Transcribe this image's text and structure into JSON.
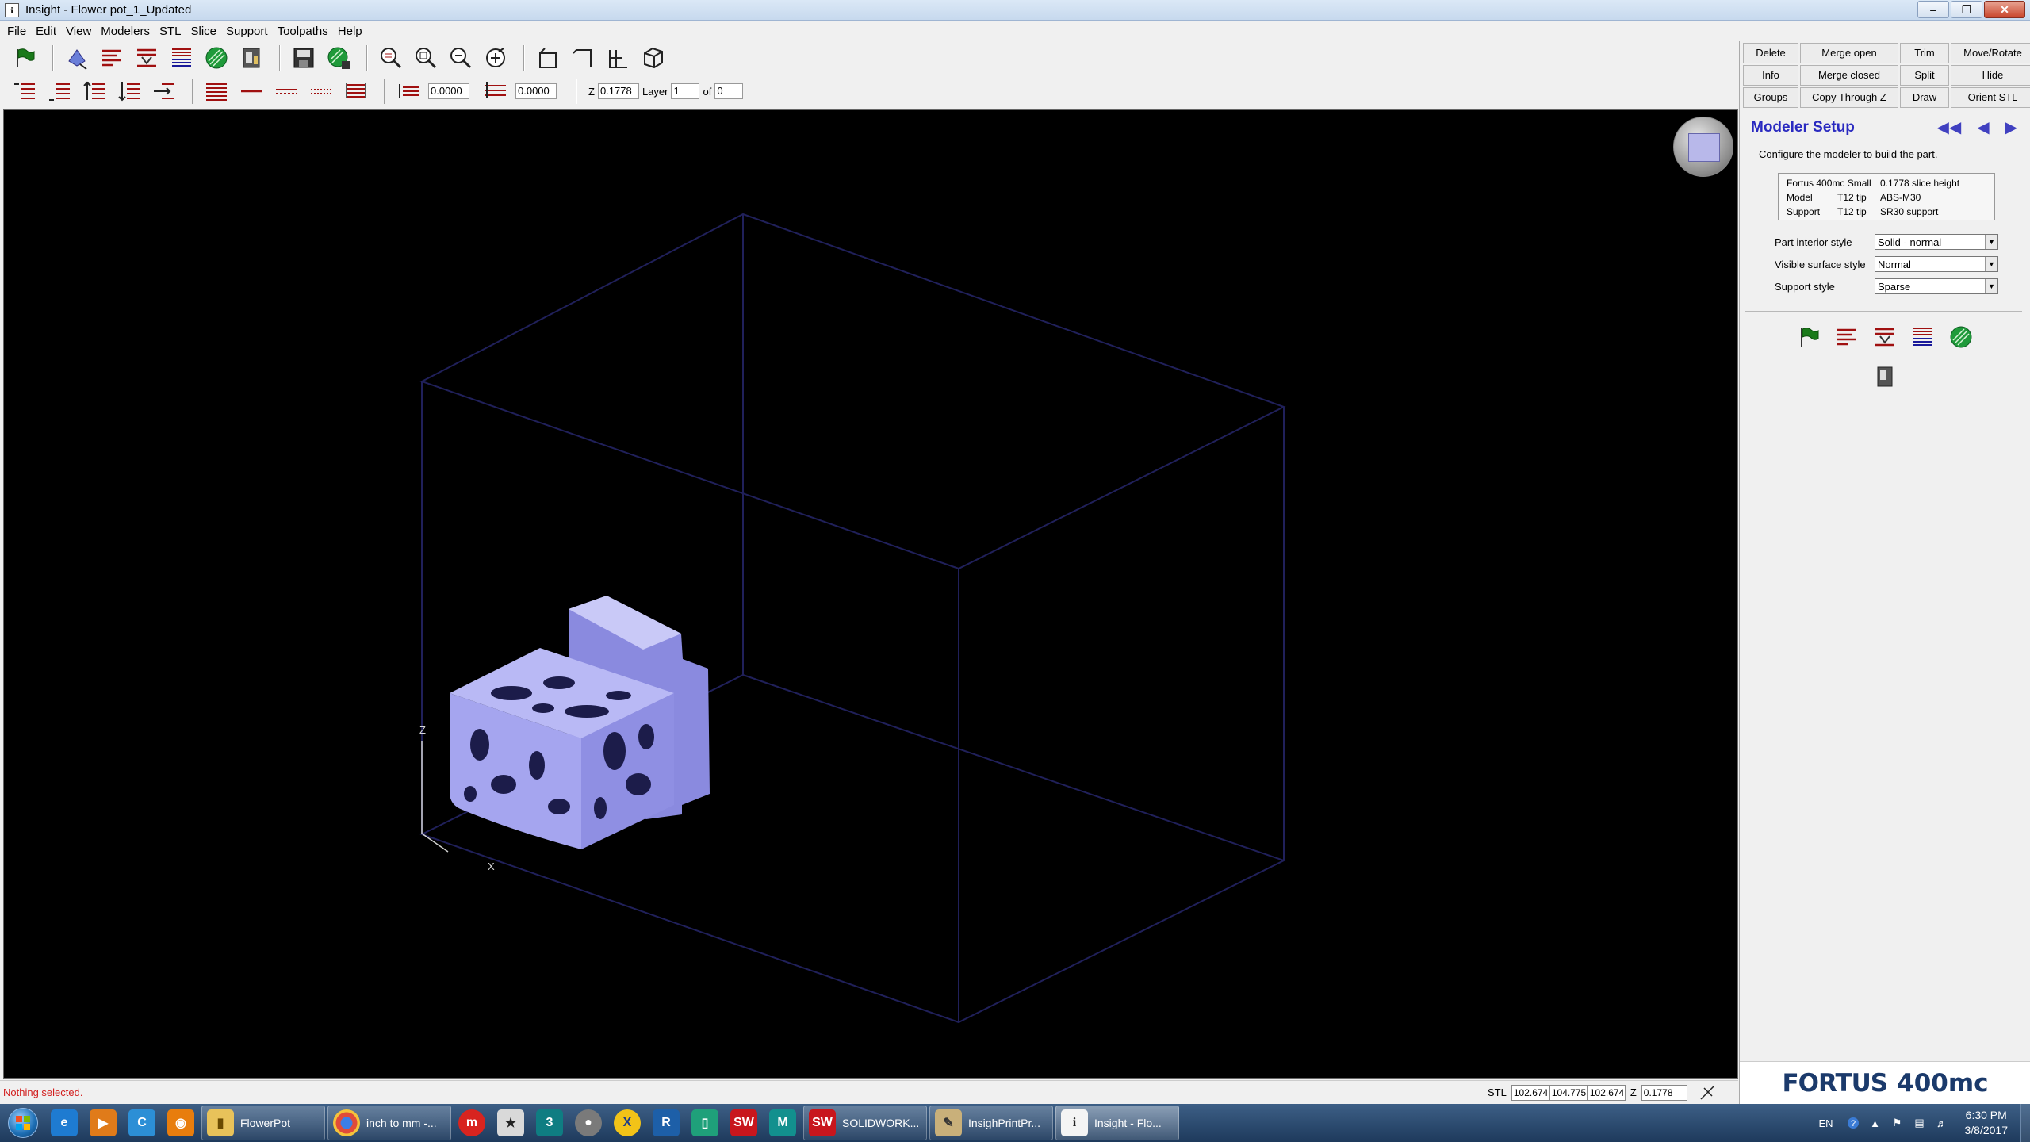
{
  "window": {
    "title": "Insight - Flower pot_1_Updated"
  },
  "menu": [
    "File",
    "Edit",
    "View",
    "Modelers",
    "STL",
    "Slice",
    "Support",
    "Toolpaths",
    "Help"
  ],
  "toolbar2": {
    "offset1": "0.0000",
    "offset2": "0.0000",
    "z_label": "Z",
    "z_value": "0.1778",
    "layer_label": "Layer",
    "layer_value": "1",
    "of_label": "of",
    "of_value": "0"
  },
  "viewport": {
    "axis_z": "Z",
    "axis_x": "X",
    "part_color": "#a5a5ef",
    "box_color": "#20205a"
  },
  "operations": [
    [
      "Delete",
      "Merge open",
      "Trim",
      "Move/Rotate"
    ],
    [
      "Info",
      "Merge closed",
      "Split",
      "Hide"
    ],
    [
      "Groups",
      "Copy Through Z",
      "Draw",
      "Orient STL"
    ]
  ],
  "panel": {
    "title": "Modeler Setup",
    "description": "Configure the modeler to build the part.",
    "info_rows": [
      [
        "Fortus 400mc Small",
        "",
        "0.1778 slice height"
      ],
      [
        "Model",
        "T12 tip",
        "ABS-M30"
      ],
      [
        "Support",
        "T12 tip",
        "SR30 support"
      ]
    ],
    "fields": [
      {
        "label": "Part interior style",
        "value": "Solid - normal"
      },
      {
        "label": "Visible surface style",
        "value": "Normal"
      },
      {
        "label": "Support style",
        "value": "Sparse"
      }
    ],
    "brand_name": "FORTUS",
    "brand_model": "400mc"
  },
  "status": {
    "message": "Nothing selected.",
    "stl_label": "STL",
    "values": [
      "102.674",
      "104.775",
      "102.674"
    ],
    "z_label": "Z",
    "z_value": "0.1778"
  },
  "taskbar": {
    "apps": [
      {
        "icon": "internet-explorer-icon",
        "label": ""
      },
      {
        "icon": "media-player-icon",
        "label": ""
      },
      {
        "icon": "ccleaner-icon",
        "label": ""
      },
      {
        "icon": "blender-icon",
        "label": ""
      },
      {
        "icon": "folder-icon",
        "label": "FlowerPot"
      },
      {
        "icon": "chrome-icon",
        "label": "inch to mm -..."
      },
      {
        "icon": "makerbot-icon",
        "label": ""
      },
      {
        "icon": "zbrush-icon",
        "label": ""
      },
      {
        "icon": "3dsmax-icon",
        "label": ""
      },
      {
        "icon": "keyshot-icon",
        "label": ""
      },
      {
        "icon": "xmind-icon",
        "label": ""
      },
      {
        "icon": "revit-icon",
        "label": ""
      },
      {
        "icon": "grabcad-icon",
        "label": ""
      },
      {
        "icon": "solidworks-2016-icon",
        "label": ""
      },
      {
        "icon": "maya-icon",
        "label": ""
      },
      {
        "icon": "solidworks-icon",
        "label": "SOLIDWORK..."
      },
      {
        "icon": "insight-print-icon",
        "label": "InsighPrintPr..."
      },
      {
        "icon": "insight-icon",
        "label": "Insight - Flo..."
      }
    ],
    "language": "EN",
    "time": "6:30 PM",
    "date": "3/8/2017"
  }
}
